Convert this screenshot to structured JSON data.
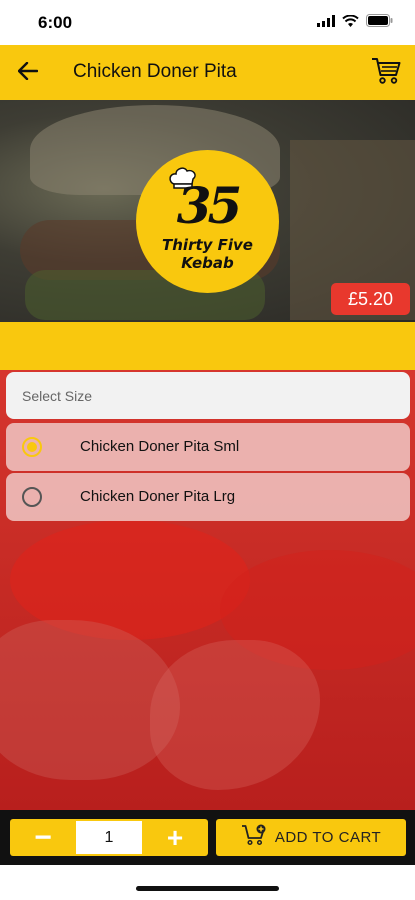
{
  "status_bar": {
    "time": "6:00"
  },
  "header": {
    "title": "Chicken Doner Pita"
  },
  "logo": {
    "number": "35",
    "line1": "Thirty Five",
    "line2": "Kebab"
  },
  "price": "£5.20",
  "size_selector": {
    "label": "Select Size",
    "options": [
      {
        "label": "Chicken Doner Pita Sml",
        "selected": true
      },
      {
        "label": "Chicken Doner Pita Lrg",
        "selected": false
      }
    ]
  },
  "cart_controls": {
    "minus_label": "−",
    "quantity": "1",
    "plus_label": "+",
    "add_to_cart_label": "ADD TO CART"
  },
  "colors": {
    "accent_yellow": "#f9c80e",
    "price_red": "#e8382d",
    "background_red": "#c52a24"
  },
  "icons": [
    "back-arrow-icon",
    "cart-icon",
    "chef-hat-icon",
    "add-to-cart-icon",
    "wifi-icon",
    "battery-icon",
    "signal-icon"
  ]
}
